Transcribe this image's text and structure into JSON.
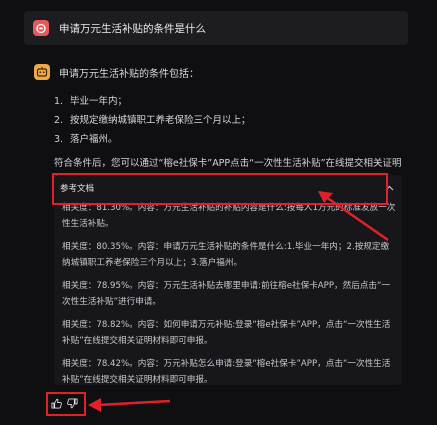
{
  "question": {
    "text": "申请万元生活补贴的条件是什么"
  },
  "answer": {
    "intro": "申请万元生活补贴的条件包括：",
    "conditions": [
      {
        "num": "1.",
        "text": "毕业一年内；"
      },
      {
        "num": "2.",
        "text": "按规定缴纳城镇职工养老保险三个月以上；"
      },
      {
        "num": "3.",
        "text": "落户福州。"
      }
    ],
    "summary": "符合条件后，您可以通过“榕e社保卡”APP点击“一次性生活补贴”在线提交相关证明材料进行申请。"
  },
  "references": {
    "title": "参考文档",
    "items": [
      {
        "text": "相关度：81.30%。内容：万元生活补贴的补贴内容是什么:按每人1万元的标准发放一次性生活补贴。"
      },
      {
        "text": "相关度：80.35%。内容：申请万元生活补贴的条件是什么:1.毕业一年内；2.按规定缴纳城镇职工养老保险三个月以上；3.落户福州。"
      },
      {
        "text": "相关度：78.95%。内容：万元生活补贴去哪里申请:前往榕e社保卡APP，然后点击“一次性生活补贴”进行申请。"
      },
      {
        "text": "相关度：78.82%。内容：如何申请万元补贴:登录“榕e社保卡”APP，点击“一次性生活补贴”在线提交相关证明材料即可申报。"
      },
      {
        "text": "相关度：78.42%。内容：万元补贴怎么申请:登录“榕e社保卡”APP，点击“一次性生活补贴”在线提交相关证明材料即可申报。"
      }
    ]
  },
  "colors": {
    "background": "#0f0f12",
    "question_bar": "#1c1c21",
    "user_avatar": "#e85a5a",
    "bot_avatar": "#f0a94a",
    "annotation_red": "#e0212a"
  },
  "icons": {
    "user_avatar": "robot-face-icon",
    "bot_avatar": "bot-face-icon",
    "collapse": "chevron-up-icon",
    "like": "thumbs-up-icon",
    "dislike": "thumbs-down-icon"
  }
}
